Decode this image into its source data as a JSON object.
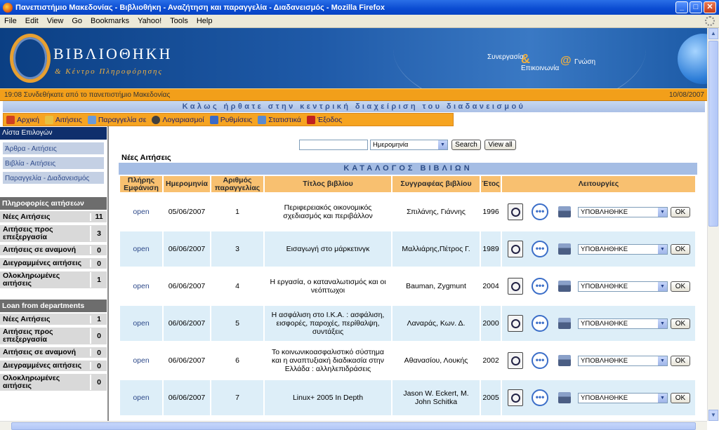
{
  "window": {
    "title": "Πανεπιστήμιο Μακεδονίας - Βιβλιοθήκη - Αναζήτηση και παραγγελία - Διαδανεισμός - Mozilla Firefox",
    "minimize": "_",
    "maximize": "□",
    "close": "✕"
  },
  "menu": [
    "File",
    "Edit",
    "View",
    "Go",
    "Bookmarks",
    "Yahoo!",
    "Tools",
    "Help"
  ],
  "banner": {
    "logo_title": "ΒΙΒΛΙΟΘΗΚΗ",
    "logo_subtitle": "& Κέντρο Πληροφόρησης",
    "slogan_1": "Συνεργασία",
    "slogan_2": "Επικοινωνία",
    "slogan_3": "Γνώση",
    "amp": "&",
    "at": "@"
  },
  "status_bar": {
    "left": "19:08 Συνδεθήκατε από το πανεπιστήμιο Μακεδονίας",
    "right": "10/08/2007"
  },
  "welcome": "Καλως ήρθατε στην κεντρική διαχείριση του διαδανεισμού",
  "nav": [
    {
      "label": "Αρχική",
      "icon": "home-icon",
      "color": "#d04020"
    },
    {
      "label": "Αιτήσεις",
      "icon": "requests-icon",
      "color": "#e8c040"
    },
    {
      "label": "Παραγγελία σε",
      "icon": "order-icon",
      "color": "#6a9ad8"
    },
    {
      "label": "Λογαριασμοί",
      "icon": "accounts-icon",
      "color": "#404040"
    },
    {
      "label": "Ρυθμίσεις",
      "icon": "settings-icon",
      "color": "#3a6ac8"
    },
    {
      "label": "Στατιστικά",
      "icon": "statistics-icon",
      "color": "#5a8ad0"
    },
    {
      "label": "Έξοδος",
      "icon": "exit-icon",
      "color": "#c02020"
    }
  ],
  "sidebar": {
    "options_title": "Λίστα Επιλογών",
    "options": [
      "Άρθρα - Αιτήσεις",
      "Βιβλία - Αιτήσεις",
      "Παραγγελία - Διαδανεισμός"
    ],
    "requests_title": "Πληροφορίες αιτήσεων",
    "requests": [
      {
        "label": "Νέες Αιτήσεις",
        "value": "11"
      },
      {
        "label": "Αιτήσεις προς επεξεργασία",
        "value": "3"
      },
      {
        "label": "Αιτήσεις σε αναμονή",
        "value": "0"
      },
      {
        "label": "Διεγραμμένες αιτήσεις",
        "value": "0"
      },
      {
        "label": "Ολοκληρωμένες αιτήσεις",
        "value": "1"
      }
    ],
    "loan_title": "Loan from departments",
    "loans": [
      {
        "label": "Νέες Αιτήσεις",
        "value": "1"
      },
      {
        "label": "Αιτήσεις προς επεξεργασία",
        "value": "0"
      },
      {
        "label": "Αιτήσεις σε αναμονή",
        "value": "0"
      },
      {
        "label": "Διεγραμμένες αιτήσεις",
        "value": "0"
      },
      {
        "label": "Ολοκληρωμένες αιτήσεις",
        "value": "0"
      }
    ]
  },
  "search": {
    "query": "",
    "field": "Ημερομηνία",
    "search_button": "Search",
    "view_all_button": "View all"
  },
  "main": {
    "section_title": "Νέες Αιτήσεις",
    "catalog_title": "ΚΑΤΑΛΟΓΟΣ ΒΙΒΛΙΩΝ",
    "columns": [
      "Πλήρης Εμφάνιση",
      "Ημερομηνία",
      "Αριθμός παραγγελίας",
      "Τίτλος βιβλίου",
      "Συγγραφέας βιβλίου",
      "Έτος",
      "Λειτουργίες"
    ],
    "rows": [
      {
        "link": "open",
        "date": "05/06/2007",
        "order": "1",
        "title": "Περιφερειακός οικονομικός σχεδιασμός και περιβάλλον",
        "author": "Σπιλάνης, Γιάννης",
        "year": "1996",
        "status": "ΥΠΟΒΛΗΘΗΚΕ",
        "ok": "OK"
      },
      {
        "link": "open",
        "date": "06/06/2007",
        "order": "3",
        "title": "Εισαγωγή στο μάρκετινγκ",
        "author": "Μαλλιάρης,Πέτρος Γ.",
        "year": "1989",
        "status": "ΥΠΟΒΛΗΘΗΚΕ",
        "ok": "OK"
      },
      {
        "link": "open",
        "date": "06/06/2007",
        "order": "4",
        "title": "Η εργασία, ο καταναλωτισμός και οι νεόπτωχοι",
        "author": "Bauman, Zygmunt",
        "year": "2004",
        "status": "ΥΠΟΒΛΗΘΗΚΕ",
        "ok": "OK"
      },
      {
        "link": "open",
        "date": "06/06/2007",
        "order": "5",
        "title": "Η ασφάλιση στο Ι.Κ.Α. : ασφάλιση, εισφορές, παροχές, περίθαλψη, συντάξεις",
        "author": "Λαναράς, Κων. Δ.",
        "year": "2000",
        "status": "ΥΠΟΒΛΗΘΗΚΕ",
        "ok": "OK"
      },
      {
        "link": "open",
        "date": "06/06/2007",
        "order": "6",
        "title": "Το κοινωνικοασφαλιστικό σύστημα και η αναπτυξιακή διαδικασία στην Ελλάδα : αλληλεπιδράσεις",
        "author": "Αθανασίου, Λουκής",
        "year": "2002",
        "status": "ΥΠΟΒΛΗΘΗΚΕ",
        "ok": "OK"
      },
      {
        "link": "open",
        "date": "06/06/2007",
        "order": "7",
        "title": "Linux+ 2005 In Depth",
        "author": "Jason W. Eckert, M. John Schitka",
        "year": "2005",
        "status": "ΥΠΟΒΛΗΘΗΚΕ",
        "ok": "OK"
      }
    ],
    "more_glyph": "•••"
  }
}
